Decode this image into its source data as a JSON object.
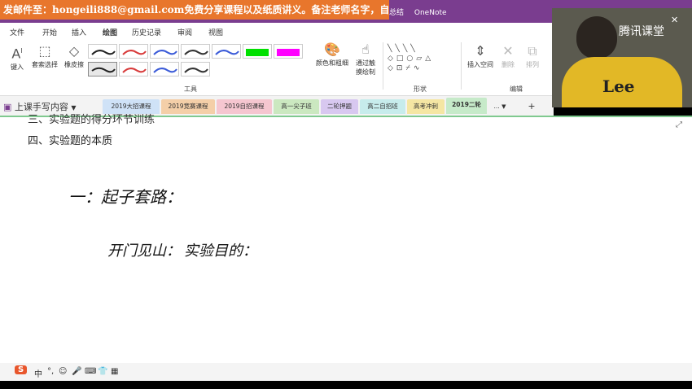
{
  "promo_banner": "发邮件至：hongeili888@gmail.com免费分享课程以及纸质讲义。备注老师名字，自动回复！",
  "window": {
    "title_fragment": "总结",
    "app_name": "OneNote"
  },
  "menu_tabs": [
    "文件",
    "开始",
    "插入",
    "绘图",
    "历史记录",
    "审阅",
    "视图"
  ],
  "active_tab": "绘图",
  "ribbon": {
    "tools": [
      {
        "label": "键入",
        "icon": "type-icon"
      },
      {
        "label": "套索选择",
        "icon": "lasso-icon"
      },
      {
        "label": "橡皮擦",
        "icon": "eraser-icon"
      }
    ],
    "pen_colors": [
      "#222222",
      "#d83b3b",
      "#3b5bd8",
      "#333333",
      "#3b5bd8",
      "#00e000",
      "#ff00ff",
      "#222222",
      "#d83b3b",
      "#3b5bd8",
      "#333333"
    ],
    "color_thickness_label": "颜色和粗细",
    "touch_draw_label": "通过触摸绘制",
    "tools_group_label": "工具",
    "shapes_group_label": "形状",
    "insert_space_label": "插入空间",
    "delete_label": "删除",
    "arrange_label": "排列",
    "edit_group_label": "编辑"
  },
  "notebook_name": "上课手写内容",
  "sections": [
    {
      "label": "2019大招课程",
      "color": "#cfe2f7"
    },
    {
      "label": "2019竞赛课程",
      "color": "#f4cfa8"
    },
    {
      "label": "2019自招课程",
      "color": "#f5c6d0"
    },
    {
      "label": "高一尖子班",
      "color": "#cbe8c0"
    },
    {
      "label": "二轮押题",
      "color": "#d8c8f0"
    },
    {
      "label": "高二自招班",
      "color": "#c7ecec"
    },
    {
      "label": "高考冲刺",
      "color": "#f5e6a3"
    },
    {
      "label": "2019二轮",
      "color": "#c6eac9"
    },
    {
      "label": "...",
      "color": "#f3f3f3"
    }
  ],
  "page": {
    "outline_partial": "三、实验题的得分环节训练",
    "outline_item": "四、实验题的本质",
    "handwriting_line1": "一：起子套路：",
    "handwriting_line2a": "开门见山：",
    "handwriting_line2b": "实验目的："
  },
  "taskbar_items": [
    "S",
    "中",
    "°,",
    "☺",
    "🎤",
    "⌨",
    "👕",
    "▦"
  ],
  "webcam": {
    "logo": "腾讯课堂",
    "shirt_text": "Lee"
  }
}
